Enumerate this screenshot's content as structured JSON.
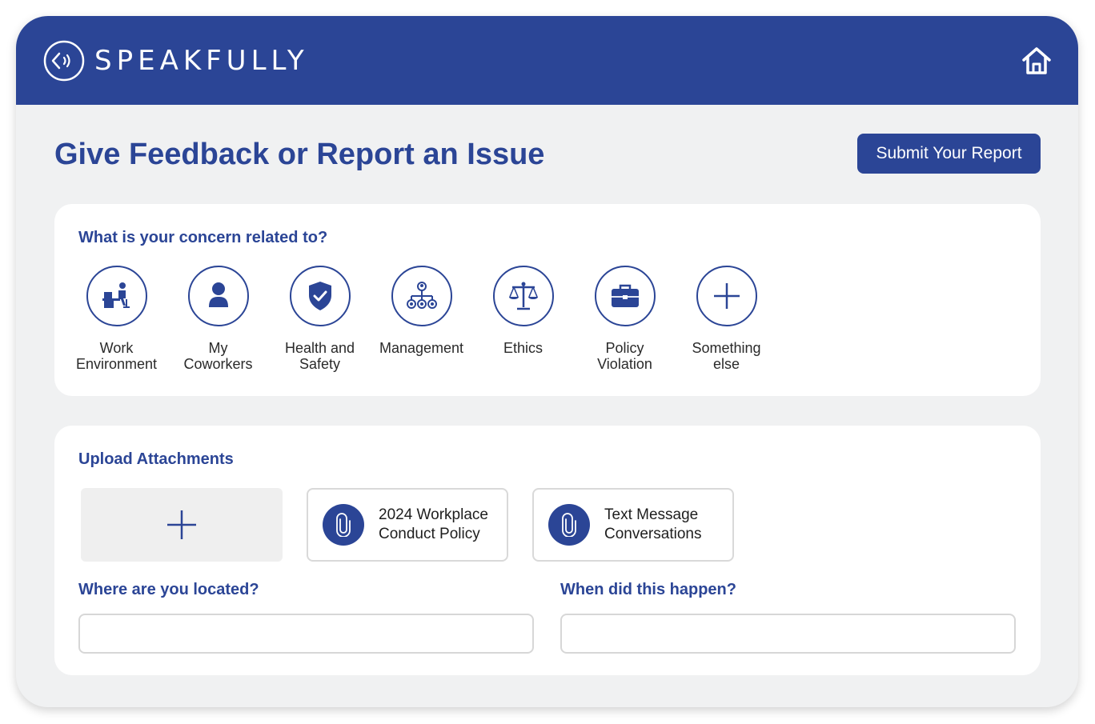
{
  "app": {
    "logo_text": "SPEAKFULLY",
    "brand_color": "#2b4596",
    "home_icon": "home-icon"
  },
  "page": {
    "title": "Give Feedback or Report an Issue",
    "submit_label": "Submit Your Report"
  },
  "concern": {
    "heading": "What is your concern related to?",
    "categories": [
      {
        "label": "Work\nEnvironment",
        "icon": "desk-worker-icon"
      },
      {
        "label": "My\nCoworkers",
        "icon": "person-icon"
      },
      {
        "label": "Health and\nSafety",
        "icon": "shield-check-icon"
      },
      {
        "label": "Management",
        "icon": "org-chart-icon"
      },
      {
        "label": "Ethics",
        "icon": "scales-icon"
      },
      {
        "label": "Policy\nViolation",
        "icon": "briefcase-icon"
      },
      {
        "label": "Something\nelse",
        "icon": "plus-icon"
      }
    ]
  },
  "attachments": {
    "heading": "Upload Attachments",
    "add_icon": "plus-icon",
    "files": [
      {
        "name": "2024 Workplace\nConduct Policy",
        "icon": "paperclip-icon"
      },
      {
        "name": "Text Message\nConversations",
        "icon": "paperclip-icon"
      }
    ]
  },
  "location": {
    "label": "Where are you located?",
    "value": ""
  },
  "when": {
    "label": "When did this happen?",
    "value": ""
  }
}
